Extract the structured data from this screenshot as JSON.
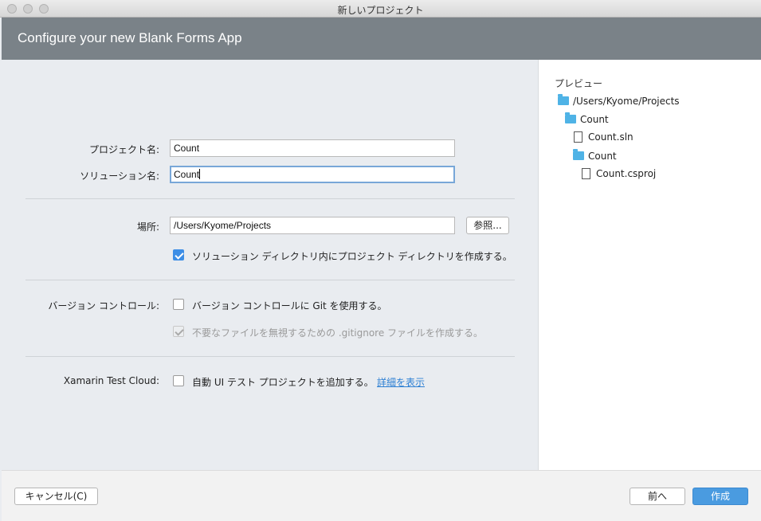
{
  "window": {
    "title": "新しいプロジェクト"
  },
  "header": {
    "title": "Configure your new Blank Forms App"
  },
  "form": {
    "project_name_label": "プロジェクト名:",
    "project_name_value": "Count",
    "solution_name_label": "ソリューション名:",
    "solution_name_value": "Count",
    "location_label": "場所:",
    "location_value": "/Users/Kyome/Projects",
    "browse_label": "参照...",
    "create_dir_label": "ソリューション ディレクトリ内にプロジェクト ディレクトリを作成する。",
    "create_dir_checked": true,
    "vc_label": "バージョン コントロール:",
    "vc_checkbox_label": "バージョン コントロールに Git を使用する。",
    "vc_checked": false,
    "gitignore_label": "不要なファイルを無視するための .gitignore ファイルを作成する。",
    "gitignore_checked": true,
    "gitignore_enabled": false,
    "test_cloud_label": "Xamarin Test Cloud:",
    "test_cloud_checkbox_label": "自動 UI テスト プロジェクトを追加する。",
    "test_cloud_checked": false,
    "details_link": "詳細を表示"
  },
  "preview": {
    "title": "プレビュー",
    "tree": [
      {
        "type": "folder",
        "label": "/Users/Kyome/Projects"
      },
      {
        "type": "folder",
        "label": "Count"
      },
      {
        "type": "file",
        "label": "Count.sln"
      },
      {
        "type": "folder",
        "label": "Count"
      },
      {
        "type": "file",
        "label": "Count.csproj"
      }
    ]
  },
  "footer": {
    "cancel_label": "キャンセル(C)",
    "back_label": "前へ",
    "create_label": "作成"
  },
  "colors": {
    "header": "#7a8288",
    "accent": "#4a9be0",
    "link": "#2d7fd3",
    "folder": "#4fb3e6"
  }
}
